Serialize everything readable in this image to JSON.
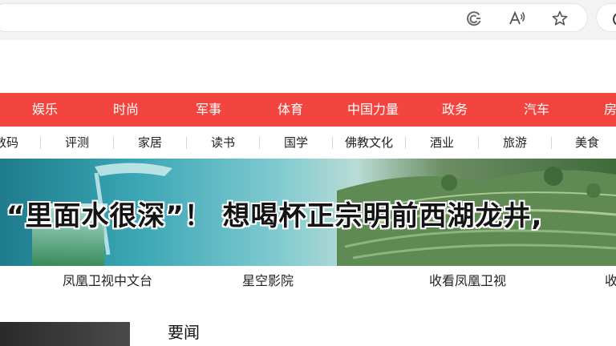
{
  "browser": {
    "icons": [
      "collections-icon",
      "read-aloud-icon",
      "favorite-star-icon",
      "profile-icon"
    ]
  },
  "nav_main": {
    "background": "#f34540",
    "items": [
      {
        "label": "娱乐"
      },
      {
        "label": "时尚"
      },
      {
        "label": "军事"
      },
      {
        "label": "体育"
      },
      {
        "label": "中国力量"
      },
      {
        "label": "政务"
      },
      {
        "label": "汽车"
      },
      {
        "label": "房"
      }
    ]
  },
  "nav_sub": {
    "items": [
      {
        "label": "数码"
      },
      {
        "label": "评测"
      },
      {
        "label": "家居"
      },
      {
        "label": "读书"
      },
      {
        "label": "国学"
      },
      {
        "label": "佛教文化"
      },
      {
        "label": "酒业"
      },
      {
        "label": "旅游"
      },
      {
        "label": "美食"
      }
    ]
  },
  "banner": {
    "headline": "“里面水很深”！ 想喝杯正宗明前西湖龙井,"
  },
  "channels": {
    "items": [
      {
        "label": "凤凰卫视中文台"
      },
      {
        "label": "星空影院"
      },
      {
        "label": "收看凤凰卫视"
      },
      {
        "label": "收"
      }
    ]
  },
  "news": {
    "section_title": "要闻"
  }
}
